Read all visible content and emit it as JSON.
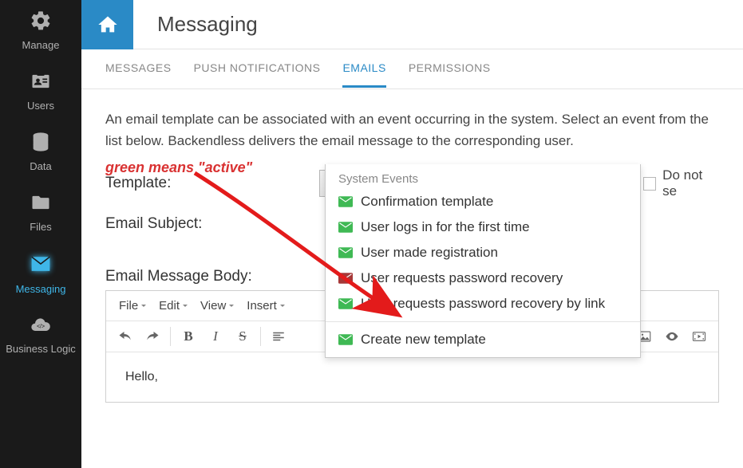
{
  "sidebar": {
    "items": [
      {
        "label": "Manage"
      },
      {
        "label": "Users"
      },
      {
        "label": "Data"
      },
      {
        "label": "Files"
      },
      {
        "label": "Messaging"
      },
      {
        "label": "Business Logic"
      }
    ]
  },
  "header": {
    "title": "Messaging"
  },
  "tabs": [
    {
      "label": "MESSAGES"
    },
    {
      "label": "PUSH NOTIFICATIONS"
    },
    {
      "label": "EMAILS"
    },
    {
      "label": "PERMISSIONS"
    }
  ],
  "content": {
    "intro": "An email template can be associated with an event occurring in the system. Select an event from the list below. Backendless delivers the email message to the corresponding user.",
    "template_label": "Template:",
    "subject_label": "Email Subject:",
    "body_label": "Email Message Body:",
    "do_not_send": "Do not se",
    "selected_template": "Confirmation template"
  },
  "annotation": "green means \"active\"",
  "dropdown": {
    "section": "System Events",
    "items": [
      {
        "label": "Confirmation template",
        "icon": "green"
      },
      {
        "label": "User logs in for the first time",
        "icon": "green"
      },
      {
        "label": "User made registration",
        "icon": "green"
      },
      {
        "label": "User requests password recovery",
        "icon": "red"
      },
      {
        "label": "User requests password recovery by link",
        "icon": "green"
      }
    ],
    "create": "Create new template"
  },
  "editor": {
    "menu": [
      {
        "label": "File"
      },
      {
        "label": "Edit"
      },
      {
        "label": "View"
      },
      {
        "label": "Insert"
      }
    ],
    "body_greeting": "Hello,"
  },
  "colors": {
    "green": "#3fb954",
    "red": "#a63838"
  }
}
